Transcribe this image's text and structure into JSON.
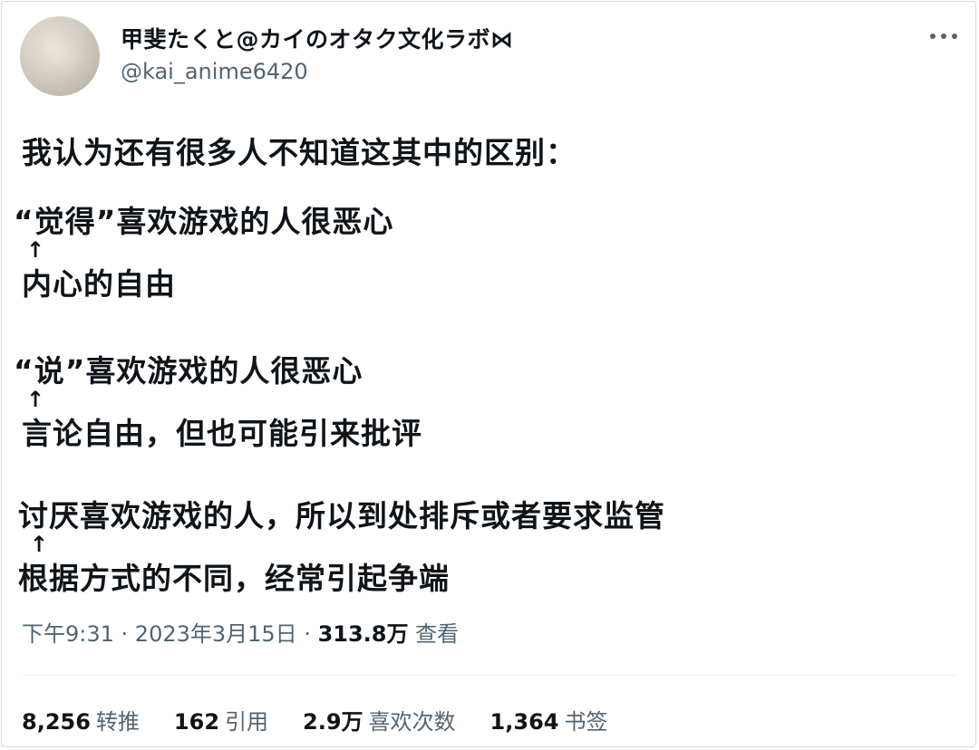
{
  "author": {
    "display_name": "甲斐たくと@カイのオタク文化ラボ⋈",
    "handle": "@kai_anime6420"
  },
  "more_icon": "more-horizontal-icon",
  "tweet": {
    "lines": [
      "我认为还有很多人不知道这其中的区别：",
      "“觉得”喜欢游戏的人很恶心",
      "↑",
      "内心的自由",
      "“说”喜欢游戏的人很恶心",
      "↑",
      "言论自由，但也可能引来批评",
      "讨厌喜欢游戏的人，所以到处排斥或者要求监管",
      "↑",
      "根据方式的不同，经常引起争端"
    ]
  },
  "meta": {
    "time": "下午9:31",
    "separator": " · ",
    "date": "2023年3月15日",
    "views_count": "313.8万",
    "views_label": " 查看"
  },
  "stats": [
    {
      "num": "8,256",
      "label": "转推"
    },
    {
      "num": "162",
      "label": "引用"
    },
    {
      "num": "2.9万",
      "label": "喜欢次数"
    },
    {
      "num": "1,364",
      "label": "书签"
    }
  ],
  "colors": {
    "text_primary": "#0f1419",
    "text_secondary": "#536471",
    "border": "#d7dadd"
  }
}
